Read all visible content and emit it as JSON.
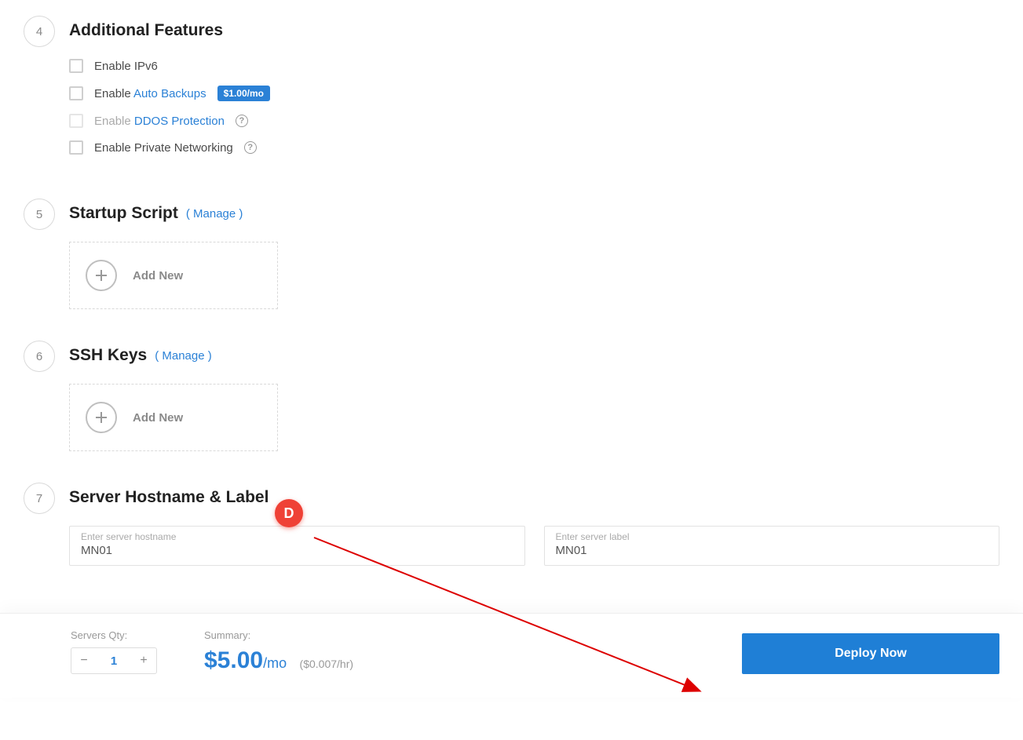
{
  "sections": {
    "s4": {
      "num": "4",
      "title": "Additional Features",
      "features": {
        "ipv6": {
          "label": "Enable IPv6"
        },
        "backups": {
          "prefix": "Enable ",
          "link": "Auto Backups",
          "badge": "$1.00/mo"
        },
        "ddos": {
          "prefix": "Enable ",
          "link": "DDOS Protection"
        },
        "priv": {
          "label": "Enable Private Networking"
        }
      }
    },
    "s5": {
      "num": "5",
      "title": "Startup Script",
      "manage": "( Manage )",
      "add": "Add New"
    },
    "s6": {
      "num": "6",
      "title": "SSH Keys",
      "manage": "( Manage )",
      "add": "Add New"
    },
    "s7": {
      "num": "7",
      "title": "Server Hostname & Label",
      "hostname": {
        "label": "Enter server hostname",
        "value": "MN01"
      },
      "serverlabel": {
        "label": "Enter server label",
        "value": "MN01"
      }
    }
  },
  "annotation": {
    "badge": "D"
  },
  "footer": {
    "qty_label": "Servers Qty:",
    "qty": "1",
    "summary_label": "Summary:",
    "price": "$5.00",
    "per": "/mo",
    "hourly": "($0.007/hr)",
    "deploy": "Deploy Now"
  }
}
